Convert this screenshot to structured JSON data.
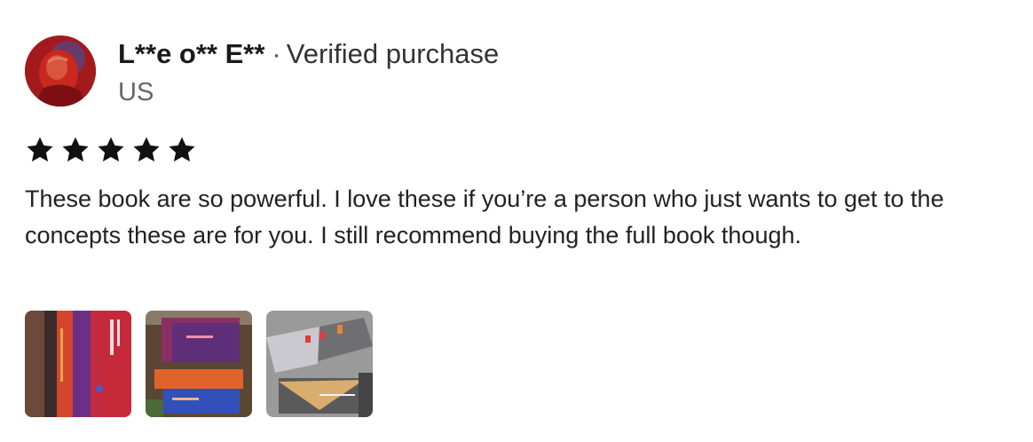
{
  "review": {
    "author": "L**e o** E**",
    "separator": "·",
    "verified_label": "Verified purchase",
    "country": "US",
    "rating": 5,
    "rating_max": 5,
    "star_color": "#111111",
    "text": "These book are so powerful. I love these if you’re a person who just wants to get to the concepts these are for you. I still recommend buying the full book though."
  },
  "photos": [
    {
      "icon": "review-photo-1"
    },
    {
      "icon": "review-photo-2"
    },
    {
      "icon": "review-photo-3"
    }
  ]
}
